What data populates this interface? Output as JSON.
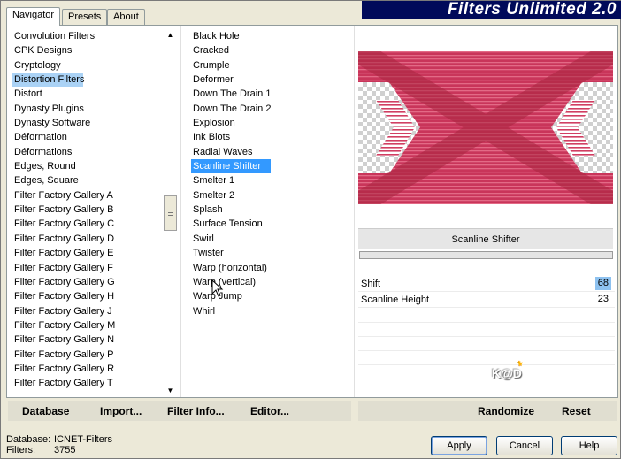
{
  "window": {
    "title": "Filters Unlimited 2.0"
  },
  "tabs": [
    {
      "label": "Navigator",
      "active": true
    },
    {
      "label": "Presets",
      "active": false
    },
    {
      "label": "About",
      "active": false
    }
  ],
  "categories": {
    "items": [
      "Convolution Filters",
      "CPK Designs",
      "Cryptology",
      "Distortion Filters",
      "Distort",
      "Dynasty Plugins",
      "Dynasty Software",
      "Déformation",
      "Déformations",
      "Edges, Round",
      "Edges, Square",
      "Filter Factory Gallery A",
      "Filter Factory Gallery B",
      "Filter Factory Gallery C",
      "Filter Factory Gallery D",
      "Filter Factory Gallery E",
      "Filter Factory Gallery F",
      "Filter Factory Gallery G",
      "Filter Factory Gallery H",
      "Filter Factory Gallery J",
      "Filter Factory Gallery M",
      "Filter Factory Gallery N",
      "Filter Factory Gallery P",
      "Filter Factory Gallery R",
      "Filter Factory Gallery T"
    ],
    "selected": "Distortion Filters"
  },
  "filters": {
    "items": [
      "Black Hole",
      "Cracked",
      "Crumple",
      "Deformer",
      "Down The Drain 1",
      "Down The Drain 2",
      "Explosion",
      "Ink Blots",
      "Radial Waves",
      "Scanline Shifter",
      "Smelter 1",
      "Smelter 2",
      "Splash",
      "Surface Tension",
      "Swirl",
      "Twister",
      "Warp (horizontal)",
      "Warp (vertical)",
      "Warp Jump",
      "Whirl"
    ],
    "selected": "Scanline Shifter"
  },
  "preview": {
    "filter_name": "Scanline Shifter"
  },
  "params": [
    {
      "name": "Shift",
      "value": "68",
      "highlighted": true
    },
    {
      "name": "Scanline Height",
      "value": "23",
      "highlighted": false
    }
  ],
  "watermark": {
    "text": "K@D"
  },
  "toolbar": {
    "database": "Database",
    "import": "Import...",
    "filter_info": "Filter Info...",
    "editor": "Editor...",
    "randomize": "Randomize",
    "reset": "Reset"
  },
  "status": {
    "database_label": "Database:",
    "database_value": "ICNET-Filters",
    "filters_label": "Filters:",
    "filters_value": "3755"
  },
  "buttons": {
    "apply": "Apply",
    "cancel": "Cancel",
    "help": "Help"
  },
  "colors": {
    "selection": "#3399ff",
    "banner": "#000a5a",
    "preview": "#c9355a"
  }
}
